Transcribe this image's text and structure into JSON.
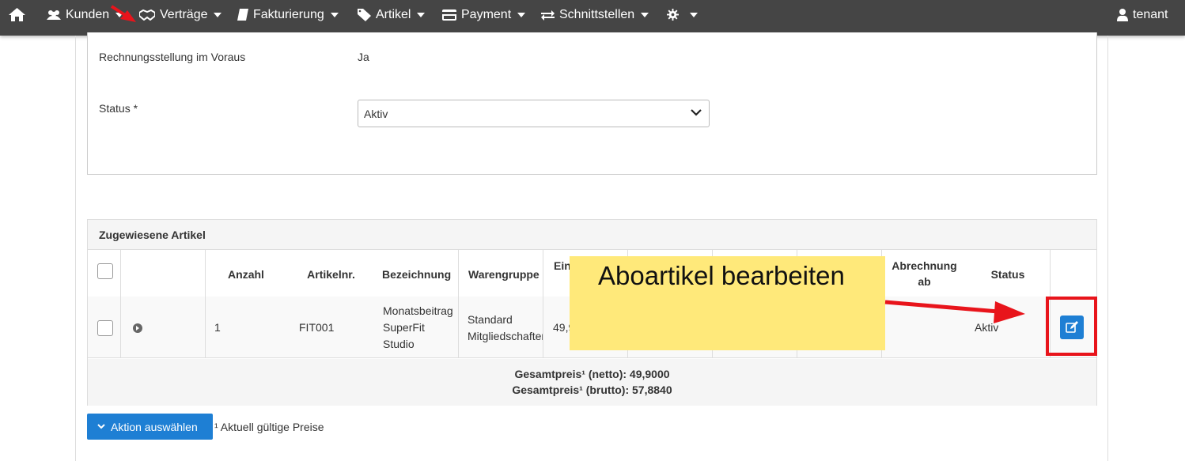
{
  "nav": {
    "home_icon": "home-icon",
    "items": [
      {
        "label": "Kunden",
        "icon": "users-icon"
      },
      {
        "label": "Verträge",
        "icon": "handshake-icon"
      },
      {
        "label": "Fakturierung",
        "icon": "book-icon"
      },
      {
        "label": "Artikel",
        "icon": "tag-icon"
      },
      {
        "label": "Payment",
        "icon": "credit-card-icon"
      },
      {
        "label": "Schnittstellen",
        "icon": "exchange-icon"
      }
    ],
    "settings_icon": "gear-icon",
    "user_label": "tenant"
  },
  "form": {
    "advance_billing_label": "Rechnungsstellung im Voraus",
    "advance_billing_value": "Ja",
    "status_label": "Status *",
    "status_value": "Aktiv"
  },
  "articles": {
    "title": "Zugewiesene Artikel",
    "columns": [
      "Anzahl",
      "Artikelnr.",
      "Bezeichnung",
      "Warengruppe",
      "Ein",
      "Abrechnung ab",
      "Status"
    ],
    "row": {
      "anzahl": "1",
      "artikelnr": "FIT001",
      "bezeichnung": [
        "Monatsbeitrag",
        "SuperFit",
        "Studio"
      ],
      "warengruppe": [
        "Standard",
        "Mitgliedschaften"
      ],
      "einzelpreis": "49,9",
      "status": "Aktiv"
    },
    "total_net": "Gesamtpreis¹ (netto): 49,9000",
    "total_gross": "Gesamtpreis¹ (brutto): 57,8840"
  },
  "actions": {
    "select_action_label": "Aktion auswählen",
    "footnote": "¹ Aktuell gültige Preise"
  },
  "annotation": {
    "callout_text": "Aboartikel bearbeiten",
    "accent_color": "#e8141b",
    "callout_color": "#ffe97a"
  }
}
